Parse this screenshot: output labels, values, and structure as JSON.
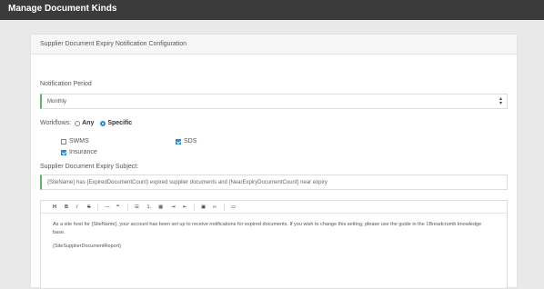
{
  "window": {
    "title": "Manage Document Kinds"
  },
  "card": {
    "header": "Supplier Document Expiry Notification Configuration",
    "notification_period": {
      "label": "Notification Period",
      "value": "Monthly"
    },
    "workflows": {
      "label": "Workflows:",
      "options": [
        {
          "label": "Any",
          "selected": false
        },
        {
          "label": "Specific",
          "selected": true
        }
      ]
    },
    "document_types": [
      {
        "label": "SWMS",
        "checked": false
      },
      {
        "label": "SDS",
        "checked": true
      },
      {
        "label": "Insurance",
        "checked": true
      }
    ],
    "subject": {
      "label": "Supplier Document Expiry Subject:",
      "value": "{SiteName} has {ExpiredDocumentCount} expired supplier documents and {NearExpiryDocumentCount} near expiry"
    },
    "editor": {
      "toolbar": {
        "heading": "H",
        "bold": "B",
        "italic": "I",
        "strike": "S",
        "hr": "—",
        "quote": "❝",
        "ul": "☰",
        "ol": "⒈",
        "table": "▦",
        "indent": "⇥",
        "outdent": "⇤",
        "image": "▣",
        "link": "∞",
        "code": "▭"
      },
      "paragraphs": [
        "As a site host for {SiteName}, your account has been set up to receive notifications for expired documents. If you wish to change this setting, please use the guide in the 1Breadcrumb knowledge base.",
        "{SiteSupplierDocumentReport}"
      ]
    }
  }
}
